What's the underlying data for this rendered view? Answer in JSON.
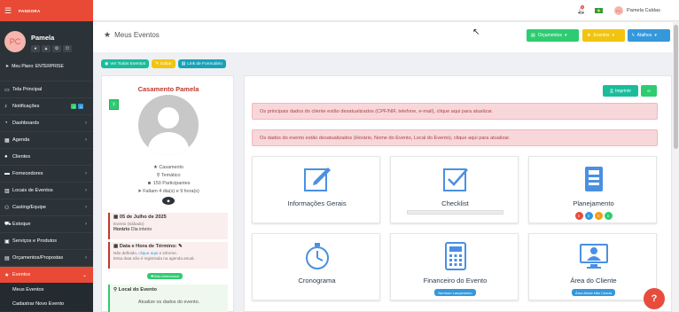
{
  "brand": {
    "name": "PANDORA"
  },
  "profile": {
    "initials": "PC",
    "name": "Pamela",
    "plan": "Meu Plano: ENTERPRISE"
  },
  "nav": {
    "items": [
      {
        "label": "Tela Principal"
      },
      {
        "label": "Notificações",
        "badge1": "0",
        "badge2": "0"
      },
      {
        "label": "Dashboards"
      },
      {
        "label": "Agenda"
      },
      {
        "label": "Clientes"
      },
      {
        "label": "Fornecedores"
      },
      {
        "label": "Locais de Eventos"
      },
      {
        "label": "Casting/Equipe"
      },
      {
        "label": "Estoque"
      },
      {
        "label": "Serviços e Produtos"
      },
      {
        "label": "Orçamentos/Propostas"
      },
      {
        "label": "Eventos"
      }
    ],
    "sub": [
      "Meus Eventos",
      "Cadastrar Novo Evento"
    ]
  },
  "topbar": {
    "notif_count": "0",
    "user_initials": "PC",
    "user_name": "Pamela Caldas"
  },
  "title": {
    "text": "Meus Eventos"
  },
  "header_buttons": {
    "budgets": "Orçamentos",
    "events": "Eventos",
    "shortcuts": "Atalhos"
  },
  "actions": {
    "view_all": "Ver Todos Eventos",
    "edit": "Editar",
    "form_link": "Link de Formulário"
  },
  "event": {
    "name": "Casamento Pamela",
    "type": "Casamento",
    "theme": "Temático",
    "participants": "150 Participantes",
    "countdown": "Faltam 4 dia(s) e 9 hora(s)",
    "date_title": "05 de Julho de 2025",
    "date_day": "Evento (Sábado)",
    "time_label": "Horário",
    "time_value": "Dia inteiro",
    "end_title": "Data e Hora de Término:",
    "end_undef": "Não definido,",
    "end_link": "clique aqui",
    "end_tail": "e informe.",
    "end_note": "Essa data não é registrada na agenda anual.",
    "status": "Dias Antecessor",
    "location_title": "Local do Evento",
    "location_msg": "Atualize os dados do evento."
  },
  "right": {
    "print": "Imprimir",
    "alert1": "Os principais dados do cliente estão desatualizados (CPF/NIF, telefone, e-mail), clique aqui para atualizar.",
    "alert2": "Os dados do evento estão desatualizados (Horário, Nome do Evento, Local do Evento), clique aqui para atualizar.",
    "tiles": [
      {
        "label": "Informações Gerais",
        "icon": "edit-icon"
      },
      {
        "label": "Checklist",
        "icon": "checklist-icon"
      },
      {
        "label": "Planejamento",
        "icon": "planning-icon",
        "dots": [
          "0",
          "0",
          "0",
          "0"
        ]
      },
      {
        "label": "Cronograma",
        "icon": "stopwatch-icon"
      },
      {
        "label": "Financeiro do Evento",
        "icon": "calculator-icon",
        "pill": "Nenhum Lançamento"
      },
      {
        "label": "Área do Cliente",
        "icon": "client-area-icon",
        "pill": "Área Ainda Não Criada"
      }
    ]
  },
  "colors": {
    "primary": "#e94a35",
    "sidebar": "#2b3338",
    "alert_bg": "#f8d7da",
    "icon_blue": "#4a90e2"
  }
}
